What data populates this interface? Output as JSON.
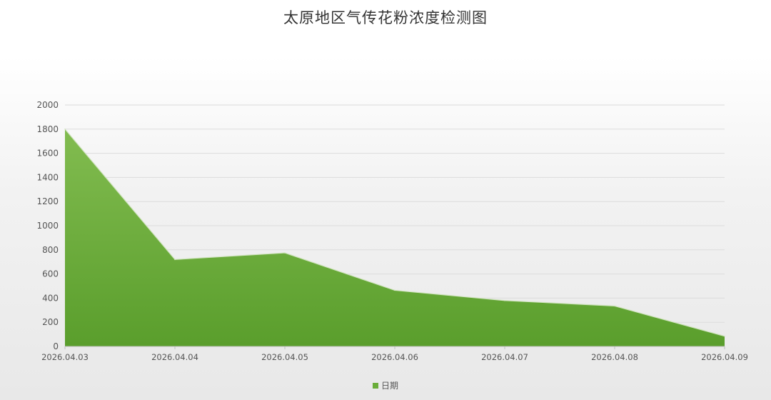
{
  "chart_data": {
    "type": "area",
    "title": "太原地区气传花粉浓度检测图",
    "categories": [
      "2026.04.03",
      "2026.04.04",
      "2026.04.05",
      "2026.04.06",
      "2026.04.07",
      "2026.04.08",
      "2026.04.09"
    ],
    "series": [
      {
        "name": "日期",
        "values": [
          1800,
          720,
          775,
          465,
          380,
          335,
          85
        ]
      }
    ],
    "ylim": [
      0,
      2000
    ],
    "yticks": [
      0,
      200,
      400,
      600,
      800,
      1000,
      1200,
      1400,
      1600,
      1800,
      2000
    ],
    "grid": true,
    "legend_position": "bottom-center",
    "colors": {
      "area_top": "#7cb84a",
      "area_bottom": "#5a9e2c",
      "legend": "#6aad3a",
      "grid": "#dcdcdc"
    }
  }
}
